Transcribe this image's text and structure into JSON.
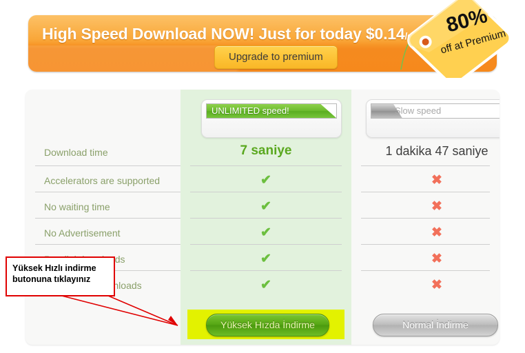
{
  "banner": {
    "headline_main": "High Speed Download NOW! Just for today $0.14",
    "headline_suffix": "/day",
    "headline_end": "!",
    "upgrade_label": "Upgrade to premium",
    "tag_percent": "80%",
    "tag_sub": "off at Premium",
    "accent_orange": "#f6891c",
    "accent_yellow": "#fdc438"
  },
  "comparison": {
    "premium_header": {
      "speed_label": "UNLIMITED speed!",
      "fill_color": "#6cbb2e",
      "column_bg": "#e2f2dd"
    },
    "free_header": {
      "speed_label": "Slow speed",
      "fill_color": "#9f9f9f",
      "column_bg": "#f8f8f7"
    },
    "time_row_label": "Download time",
    "premium_time": "7 saniye",
    "free_time": "1 dakika 47 saniye",
    "features": [
      {
        "label": "Accelerators are supported",
        "premium": "✔",
        "free": "✖"
      },
      {
        "label": "No waiting time",
        "premium": "✔",
        "free": "✖"
      },
      {
        "label": "No Advertisement",
        "premium": "✔",
        "free": "✖"
      },
      {
        "label": "Parallel downloads",
        "premium": "✔",
        "free": "✖"
      },
      {
        "label": "Resumable downloads",
        "premium": "✔",
        "free": "✖"
      }
    ],
    "premium_button": "Yüksek Hızda İndirme",
    "free_button": "Normal İndirme",
    "highlight_color": "#e3f200"
  },
  "annotation": {
    "text": "Yüksek Hızlı indirme butonuna tıklayınız",
    "border_color": "#e00000"
  }
}
